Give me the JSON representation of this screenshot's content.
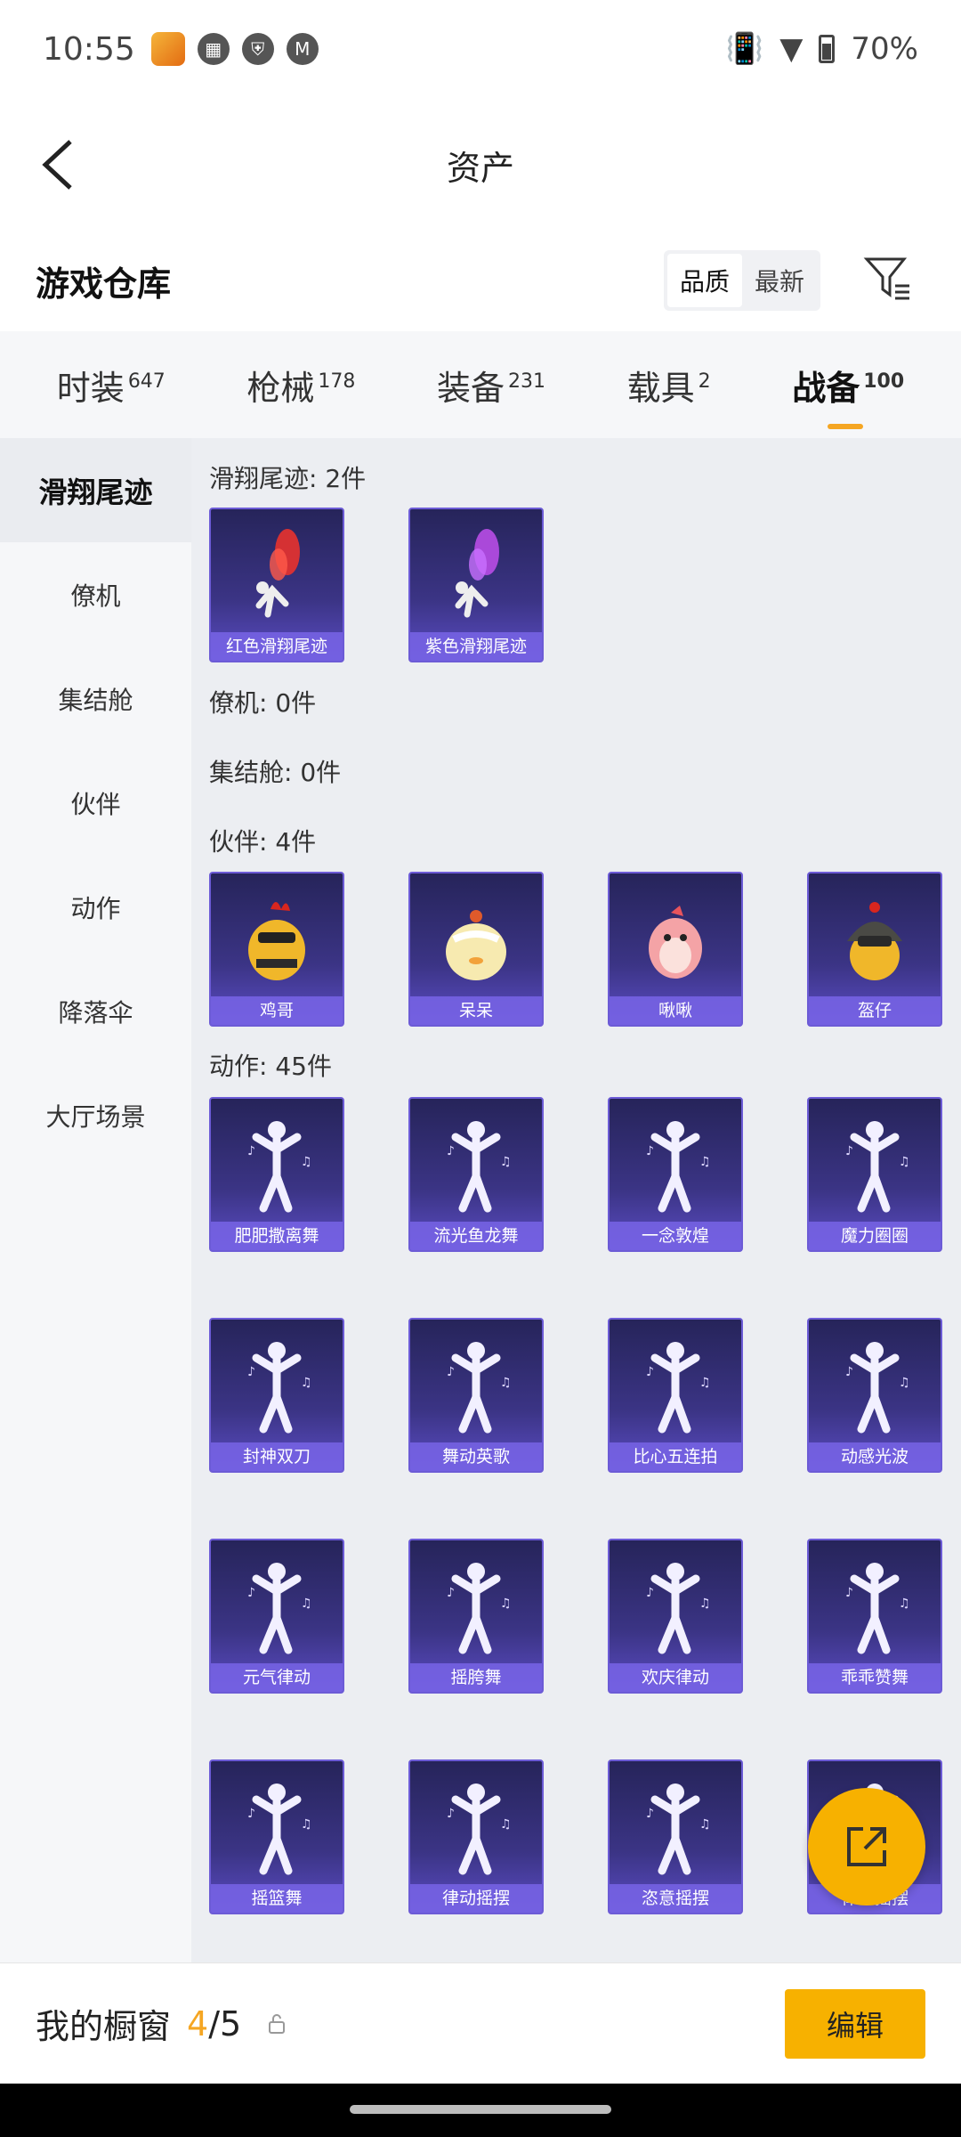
{
  "status_bar": {
    "time": "10:55",
    "battery": "70%"
  },
  "header": {
    "title": "资产"
  },
  "warehouse": {
    "title": "游戏仓库",
    "sort_options": [
      "品质",
      "最新"
    ]
  },
  "tabs": [
    {
      "label": "时装",
      "count": "647"
    },
    {
      "label": "枪械",
      "count": "178"
    },
    {
      "label": "装备",
      "count": "231"
    },
    {
      "label": "载具",
      "count": "2"
    },
    {
      "label": "战备",
      "count": "100"
    }
  ],
  "sidebar": {
    "items": [
      "滑翔尾迹",
      "僚机",
      "集结舱",
      "伙伴",
      "动作",
      "降落伞",
      "大厅场景"
    ]
  },
  "sections": {
    "trail": {
      "label": "滑翔尾迹: 2件",
      "items": [
        "红色滑翔尾迹",
        "紫色滑翔尾迹"
      ]
    },
    "wingman": {
      "label": "僚机: 0件"
    },
    "rally": {
      "label": "集结舱: 0件"
    },
    "partner": {
      "label": "伙伴: 4件",
      "items": [
        "鸡哥",
        "呆呆",
        "啾啾",
        "盔仔"
      ]
    },
    "action": {
      "label": "动作: 45件",
      "items": [
        "肥肥撒离舞",
        "流光鱼龙舞",
        "一念敦煌",
        "魔力圈圈",
        "封神双刀",
        "舞动英歌",
        "比心五连拍",
        "动感光波",
        "元气律动",
        "摇胯舞",
        "欢庆律动",
        "乖乖赞舞",
        "摇篮舞",
        "律动摇摆",
        "恣意摇摆",
        "律动摇摆"
      ]
    }
  },
  "bottom_bar": {
    "title": "我的橱窗",
    "current": "4",
    "total": "/5",
    "edit_label": "编辑"
  },
  "colors": {
    "accent": "#f7b100",
    "card_bg": "#3b3485"
  }
}
